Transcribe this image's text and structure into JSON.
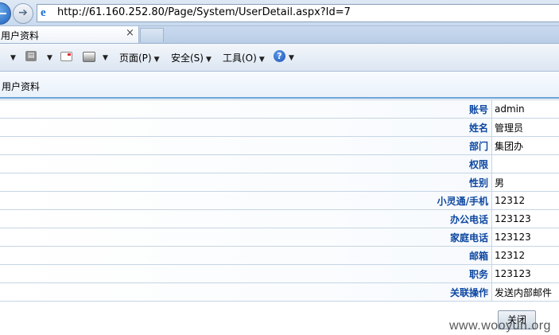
{
  "browser": {
    "url": "http://61.160.252.80/Page/System/UserDetail.aspx?Id=7",
    "tab_title": "用户资料",
    "tab_close": "×"
  },
  "command_bar": {
    "page_label": "页面(P)",
    "safety_label": "安全(S)",
    "tools_label": "工具(O)",
    "rss_glyph": "▤",
    "help_glyph": "?"
  },
  "page": {
    "title": "用户资料"
  },
  "details": {
    "rows": [
      {
        "label": "账号",
        "value": "admin"
      },
      {
        "label": "姓名",
        "value": "管理员"
      },
      {
        "label": "部门",
        "value": "集团办"
      },
      {
        "label": "权限",
        "value": ""
      },
      {
        "label": "性别",
        "value": "男"
      },
      {
        "label": "小灵通/手机",
        "value": "12312"
      },
      {
        "label": "办公电话",
        "value": "123123"
      },
      {
        "label": "家庭电话",
        "value": "123123"
      },
      {
        "label": "邮箱",
        "value": "12312"
      },
      {
        "label": "职务",
        "value": "123123"
      },
      {
        "label": "关联操作",
        "value": "发送内部邮件"
      }
    ]
  },
  "actions": {
    "close_label": "关闭"
  },
  "watermark": "www.wooyun.org"
}
